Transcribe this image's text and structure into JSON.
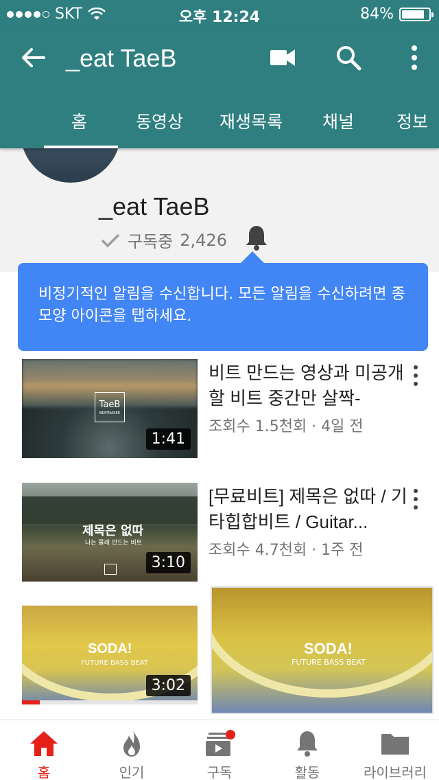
{
  "status_bar": {
    "carrier": "SKT",
    "time": "오후 12:24",
    "battery": "84%",
    "battery_level": 0.84
  },
  "app_bar": {
    "title": "_eat TaeB",
    "background": "#2f7f80"
  },
  "tabs": [
    {
      "label": "홈",
      "active": true
    },
    {
      "label": "동영상",
      "active": false
    },
    {
      "label": "재생목록",
      "active": false
    },
    {
      "label": "채널",
      "active": false
    },
    {
      "label": "정보",
      "active": false
    }
  ],
  "channel": {
    "name": "_eat TaeB",
    "subscribed_label": "구독중",
    "subscriber_count": "2,426"
  },
  "tooltip": {
    "text": "비정기적인 알림을 수신합니다. 모든 알림을 수신하려면 종 모양 아이콘을 탭하세요.",
    "color": "#4285f4"
  },
  "videos": [
    {
      "title": "비트 만드는 영상과 미공개할 비트 중간만 살짝-",
      "meta": "조회수 1.5천회 · 4일 전",
      "duration": "1:41",
      "thumb_logo": "TaeB",
      "thumb_logo_sub": "BEATMAKER"
    },
    {
      "title": "[무료비트] 제목은 없따 / 기타힙합비트 / Guitar...",
      "meta": "조회수 4.7천회 · 1주 전",
      "duration": "3:10",
      "thumb_title": "제목은 없따",
      "thumb_sub": "나는 몰래 만드는 비트"
    },
    {
      "duration": "3:02",
      "thumb_title": "SODA!",
      "thumb_sub": "FUTURE BASS BEAT",
      "watch_progress": 0.1
    }
  ],
  "mini_player": {
    "title": "SODA!",
    "sub": "FUTURE BASS BEAT"
  },
  "bottom_nav": [
    {
      "label": "홈",
      "icon": "home-icon",
      "active": true
    },
    {
      "label": "인기",
      "icon": "fire-icon",
      "active": false
    },
    {
      "label": "구독",
      "icon": "subscriptions-icon",
      "active": false
    },
    {
      "label": "활동",
      "icon": "bell-icon",
      "active": false
    },
    {
      "label": "라이브러리",
      "icon": "folder-icon",
      "active": false
    }
  ],
  "colors": {
    "accent_red": "#e62117",
    "text_secondary": "#757575"
  }
}
